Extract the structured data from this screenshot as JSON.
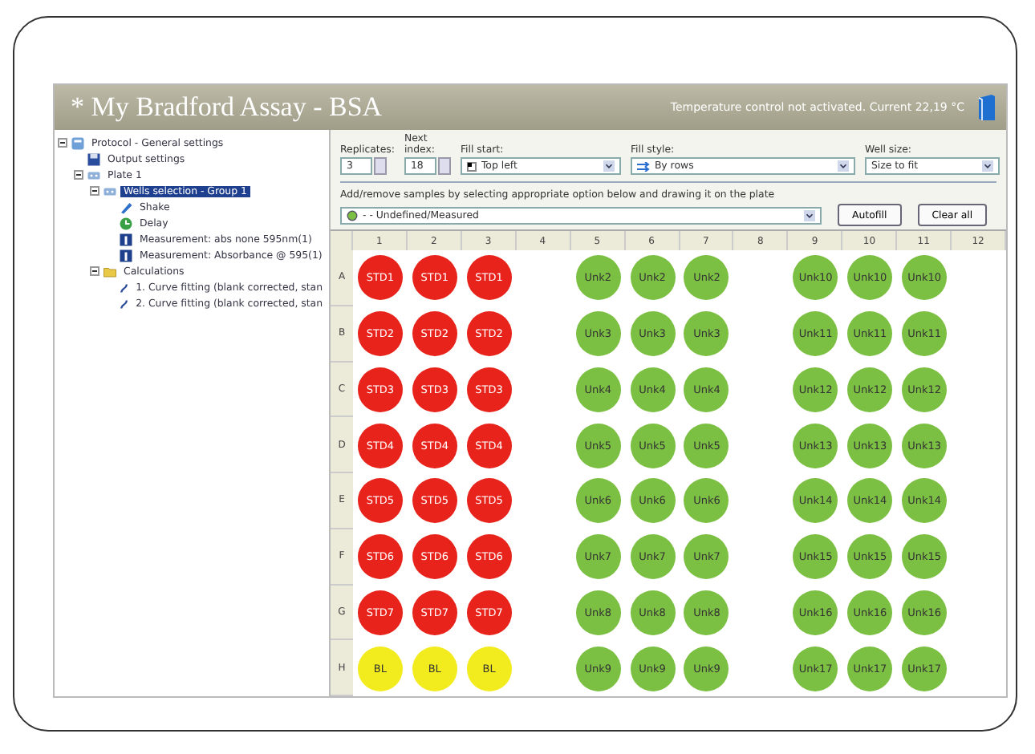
{
  "window": {
    "title": "* My Bradford Assay - BSA",
    "status": "Temperature control not activated. Current 22,19 °C"
  },
  "tree": [
    {
      "label": "Protocol - General settings",
      "kind": "protocol",
      "selected": false,
      "expanded": true,
      "children": [
        {
          "label": "Output settings",
          "kind": "disk",
          "selected": false
        },
        {
          "label": "Plate 1",
          "kind": "plate",
          "selected": false,
          "expanded": true,
          "children": [
            {
              "label": "Wells selection - Group 1",
              "kind": "plate",
              "selected": true,
              "expanded": true,
              "children": [
                {
                  "label": "Shake",
                  "kind": "shake",
                  "selected": false
                },
                {
                  "label": "Delay",
                  "kind": "delay",
                  "selected": false
                },
                {
                  "label": "Measurement: abs none 595nm(1)",
                  "kind": "measure",
                  "selected": false
                },
                {
                  "label": "Measurement: Absorbance @ 595(1)",
                  "kind": "measure",
                  "selected": false
                }
              ]
            },
            {
              "label": "Calculations",
              "kind": "folder",
              "selected": false,
              "expanded": true,
              "children": [
                {
                  "label": "1. Curve fitting (blank corrected, stan",
                  "kind": "curve",
                  "selected": false
                },
                {
                  "label": "2. Curve fitting (blank corrected, stan",
                  "kind": "curve",
                  "selected": false
                }
              ]
            }
          ]
        }
      ]
    }
  ],
  "controls": {
    "replicates": {
      "label": "Replicates:",
      "value": "3"
    },
    "next_index": {
      "label": "Next index:",
      "value": "18"
    },
    "fill_start": {
      "label": "Fill start:",
      "value": "Top left"
    },
    "fill_style": {
      "label": "Fill style:",
      "value": "By rows"
    },
    "well_size": {
      "label": "Well size:",
      "value": "Size to fit"
    },
    "instruction": "Add/remove samples by selecting appropriate option below and drawing it on the plate",
    "sample_type": "- - Undefined/Measured",
    "buttons": [
      "Autofill",
      "Clear all"
    ]
  },
  "plate": {
    "columns": [
      "1",
      "2",
      "3",
      "4",
      "5",
      "6",
      "7",
      "8",
      "9",
      "10",
      "11",
      "12"
    ],
    "rows": [
      {
        "label": "A",
        "wells": [
          {
            "kind": "sample",
            "label": "STD1",
            "color": "#e8231c"
          },
          {
            "kind": "sample",
            "label": "STD1",
            "color": "#e8231c"
          },
          {
            "kind": "sample",
            "label": "STD1",
            "color": "#e8231c"
          },
          {
            "kind": "empty"
          },
          {
            "kind": "sample",
            "label": "Unk2",
            "color": "#7cc043"
          },
          {
            "kind": "sample",
            "label": "Unk2",
            "color": "#7cc043"
          },
          {
            "kind": "sample",
            "label": "Unk2",
            "color": "#7cc043"
          },
          {
            "kind": "empty"
          },
          {
            "kind": "sample",
            "label": "Unk10",
            "color": "#7cc043"
          },
          {
            "kind": "sample",
            "label": "Unk10",
            "color": "#7cc043"
          },
          {
            "kind": "sample",
            "label": "Unk10",
            "color": "#7cc043"
          },
          {
            "kind": "empty"
          }
        ]
      },
      {
        "label": "B",
        "wells": [
          {
            "kind": "sample",
            "label": "STD2",
            "color": "#e8231c"
          },
          {
            "kind": "sample",
            "label": "STD2",
            "color": "#e8231c"
          },
          {
            "kind": "sample",
            "label": "STD2",
            "color": "#e8231c"
          },
          {
            "kind": "empty"
          },
          {
            "kind": "sample",
            "label": "Unk3",
            "color": "#7cc043"
          },
          {
            "kind": "sample",
            "label": "Unk3",
            "color": "#7cc043"
          },
          {
            "kind": "sample",
            "label": "Unk3",
            "color": "#7cc043"
          },
          {
            "kind": "empty"
          },
          {
            "kind": "sample",
            "label": "Unk11",
            "color": "#7cc043"
          },
          {
            "kind": "sample",
            "label": "Unk11",
            "color": "#7cc043"
          },
          {
            "kind": "sample",
            "label": "Unk11",
            "color": "#7cc043"
          },
          {
            "kind": "empty"
          }
        ]
      },
      {
        "label": "C",
        "wells": [
          {
            "kind": "sample",
            "label": "STD3",
            "color": "#e8231c"
          },
          {
            "kind": "sample",
            "label": "STD3",
            "color": "#e8231c"
          },
          {
            "kind": "sample",
            "label": "STD3",
            "color": "#e8231c"
          },
          {
            "kind": "empty"
          },
          {
            "kind": "sample",
            "label": "Unk4",
            "color": "#7cc043"
          },
          {
            "kind": "sample",
            "label": "Unk4",
            "color": "#7cc043"
          },
          {
            "kind": "sample",
            "label": "Unk4",
            "color": "#7cc043"
          },
          {
            "kind": "empty"
          },
          {
            "kind": "sample",
            "label": "Unk12",
            "color": "#7cc043"
          },
          {
            "kind": "sample",
            "label": "Unk12",
            "color": "#7cc043"
          },
          {
            "kind": "sample",
            "label": "Unk12",
            "color": "#7cc043"
          },
          {
            "kind": "empty"
          }
        ]
      },
      {
        "label": "D",
        "wells": [
          {
            "kind": "sample",
            "label": "STD4",
            "color": "#e8231c"
          },
          {
            "kind": "sample",
            "label": "STD4",
            "color": "#e8231c"
          },
          {
            "kind": "sample",
            "label": "STD4",
            "color": "#e8231c"
          },
          {
            "kind": "empty"
          },
          {
            "kind": "sample",
            "label": "Unk5",
            "color": "#7cc043"
          },
          {
            "kind": "sample",
            "label": "Unk5",
            "color": "#7cc043"
          },
          {
            "kind": "sample",
            "label": "Unk5",
            "color": "#7cc043"
          },
          {
            "kind": "empty"
          },
          {
            "kind": "sample",
            "label": "Unk13",
            "color": "#7cc043"
          },
          {
            "kind": "sample",
            "label": "Unk13",
            "color": "#7cc043"
          },
          {
            "kind": "sample",
            "label": "Unk13",
            "color": "#7cc043"
          },
          {
            "kind": "empty"
          }
        ]
      },
      {
        "label": "E",
        "wells": [
          {
            "kind": "sample",
            "label": "STD5",
            "color": "#e8231c"
          },
          {
            "kind": "sample",
            "label": "STD5",
            "color": "#e8231c"
          },
          {
            "kind": "sample",
            "label": "STD5",
            "color": "#e8231c"
          },
          {
            "kind": "empty"
          },
          {
            "kind": "sample",
            "label": "Unk6",
            "color": "#7cc043"
          },
          {
            "kind": "sample",
            "label": "Unk6",
            "color": "#7cc043"
          },
          {
            "kind": "sample",
            "label": "Unk6",
            "color": "#7cc043"
          },
          {
            "kind": "empty"
          },
          {
            "kind": "sample",
            "label": "Unk14",
            "color": "#7cc043"
          },
          {
            "kind": "sample",
            "label": "Unk14",
            "color": "#7cc043"
          },
          {
            "kind": "sample",
            "label": "Unk14",
            "color": "#7cc043"
          },
          {
            "kind": "empty"
          }
        ]
      },
      {
        "label": "F",
        "wells": [
          {
            "kind": "sample",
            "label": "STD6",
            "color": "#e8231c"
          },
          {
            "kind": "sample",
            "label": "STD6",
            "color": "#e8231c"
          },
          {
            "kind": "sample",
            "label": "STD6",
            "color": "#e8231c"
          },
          {
            "kind": "empty"
          },
          {
            "kind": "sample",
            "label": "Unk7",
            "color": "#7cc043"
          },
          {
            "kind": "sample",
            "label": "Unk7",
            "color": "#7cc043"
          },
          {
            "kind": "sample",
            "label": "Unk7",
            "color": "#7cc043"
          },
          {
            "kind": "empty"
          },
          {
            "kind": "sample",
            "label": "Unk15",
            "color": "#7cc043"
          },
          {
            "kind": "sample",
            "label": "Unk15",
            "color": "#7cc043"
          },
          {
            "kind": "sample",
            "label": "Unk15",
            "color": "#7cc043"
          },
          {
            "kind": "empty"
          }
        ]
      },
      {
        "label": "G",
        "wells": [
          {
            "kind": "sample",
            "label": "STD7",
            "color": "#e8231c"
          },
          {
            "kind": "sample",
            "label": "STD7",
            "color": "#e8231c"
          },
          {
            "kind": "sample",
            "label": "STD7",
            "color": "#e8231c"
          },
          {
            "kind": "empty"
          },
          {
            "kind": "sample",
            "label": "Unk8",
            "color": "#7cc043"
          },
          {
            "kind": "sample",
            "label": "Unk8",
            "color": "#7cc043"
          },
          {
            "kind": "sample",
            "label": "Unk8",
            "color": "#7cc043"
          },
          {
            "kind": "empty"
          },
          {
            "kind": "sample",
            "label": "Unk16",
            "color": "#7cc043"
          },
          {
            "kind": "sample",
            "label": "Unk16",
            "color": "#7cc043"
          },
          {
            "kind": "sample",
            "label": "Unk16",
            "color": "#7cc043"
          },
          {
            "kind": "empty"
          }
        ]
      },
      {
        "label": "H",
        "wells": [
          {
            "kind": "sample",
            "label": "BL",
            "color": "#f2ec1e"
          },
          {
            "kind": "sample",
            "label": "BL",
            "color": "#f2ec1e"
          },
          {
            "kind": "sample",
            "label": "BL",
            "color": "#f2ec1e"
          },
          {
            "kind": "empty"
          },
          {
            "kind": "sample",
            "label": "Unk9",
            "color": "#7cc043"
          },
          {
            "kind": "sample",
            "label": "Unk9",
            "color": "#7cc043"
          },
          {
            "kind": "sample",
            "label": "Unk9",
            "color": "#7cc043"
          },
          {
            "kind": "empty"
          },
          {
            "kind": "sample",
            "label": "Unk17",
            "color": "#7cc043"
          },
          {
            "kind": "sample",
            "label": "Unk17",
            "color": "#7cc043"
          },
          {
            "kind": "sample",
            "label": "Unk17",
            "color": "#7cc043"
          },
          {
            "kind": "empty"
          }
        ]
      }
    ]
  }
}
